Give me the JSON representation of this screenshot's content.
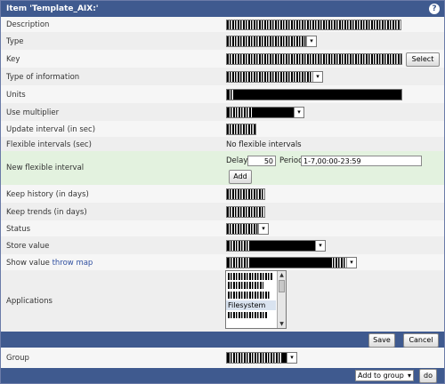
{
  "window": {
    "title": "Item 'Template_AIX:'"
  },
  "labels": {
    "description": "Description",
    "type": "Type",
    "key": "Key",
    "type_of_information": "Type of information",
    "units": "Units",
    "use_multiplier": "Use multiplier",
    "update_interval": "Update interval (in sec)",
    "flexible_intervals": "Flexible intervals (sec)",
    "new_flexible_interval": "New flexible interval",
    "keep_history": "Keep history (in days)",
    "keep_trends": "Keep trends (in days)",
    "status": "Status",
    "store_value": "Store value",
    "show_value": "Show value",
    "throw_map": "throw map",
    "applications": "Applications",
    "group": "Group"
  },
  "values": {
    "no_flexible_intervals": "No flexible intervals",
    "delay_label": "Delay",
    "delay_value": "50",
    "period_label": "Period",
    "period_value": "1-7,00:00-23:59"
  },
  "applications": {
    "selected": "Filesystem"
  },
  "buttons": {
    "select": "Select",
    "add": "Add",
    "save": "Save",
    "cancel": "Cancel",
    "go": "do"
  },
  "group_action": {
    "selected": "Add to group"
  }
}
